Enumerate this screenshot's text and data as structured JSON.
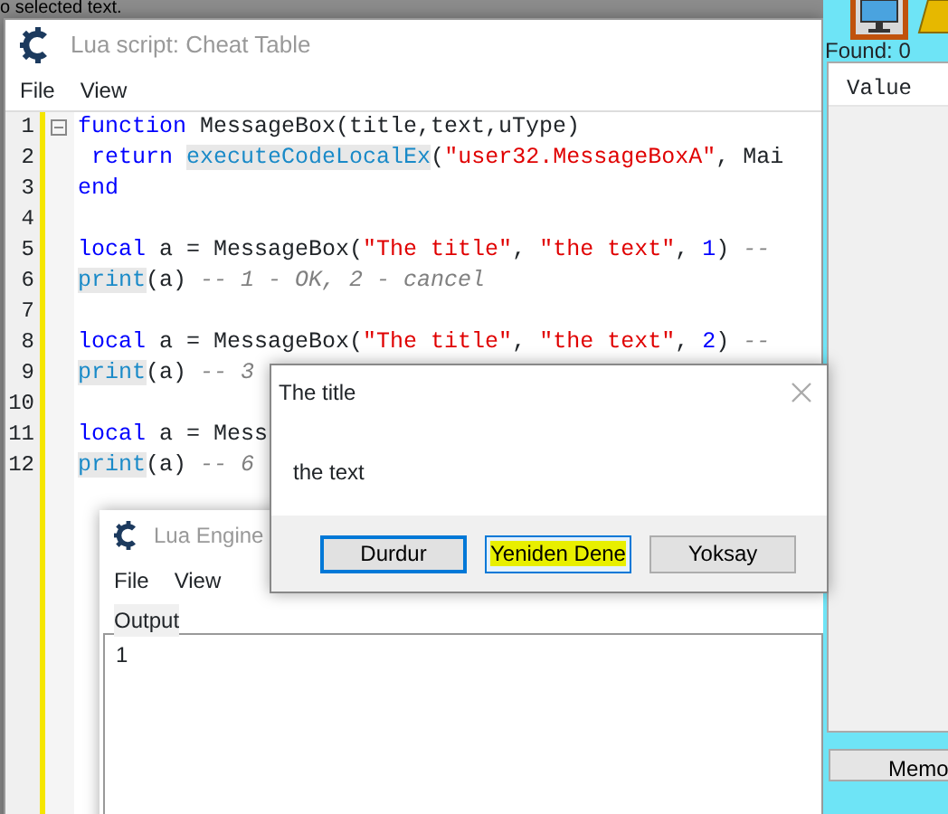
{
  "background": {
    "status_text": "o selected text."
  },
  "script_window": {
    "title": "Lua script: Cheat Table",
    "menu": [
      "File",
      "View"
    ],
    "lines": [
      {
        "number": "1",
        "fold": true,
        "tokens": [
          {
            "kind": "kw",
            "text": "function"
          },
          {
            "kind": "plain",
            "text": " MessageBox(title,text,uType)"
          }
        ]
      },
      {
        "number": "2",
        "fold": false,
        "tokens": [
          {
            "kind": "kw",
            "text": " return "
          },
          {
            "kind": "hl",
            "text": "executeCodeLocalEx"
          },
          {
            "kind": "plain",
            "text": "("
          },
          {
            "kind": "str",
            "text": "\"user32.MessageBoxA\""
          },
          {
            "kind": "plain",
            "text": ", Mai"
          }
        ]
      },
      {
        "number": "3",
        "fold": false,
        "tokens": [
          {
            "kind": "kw",
            "text": "end"
          }
        ]
      },
      {
        "number": "4",
        "fold": false
      },
      {
        "number": "5",
        "fold": false,
        "tokens": [
          {
            "kind": "kw",
            "text": "local"
          },
          {
            "kind": "plain",
            "text": " a = MessageBox("
          },
          {
            "kind": "str",
            "text": "\"The title\""
          },
          {
            "kind": "plain",
            "text": ", "
          },
          {
            "kind": "str",
            "text": "\"the text\""
          },
          {
            "kind": "plain",
            "text": ", "
          },
          {
            "kind": "num",
            "text": "1"
          },
          {
            "kind": "plain",
            "text": ") "
          },
          {
            "kind": "cmt",
            "text": "--"
          }
        ]
      },
      {
        "number": "6",
        "fold": false,
        "tokens": [
          {
            "kind": "hl",
            "text": "print"
          },
          {
            "kind": "plain",
            "text": "(a) "
          },
          {
            "kind": "cmt",
            "text": "-- 1 - OK, 2 - cancel"
          }
        ]
      },
      {
        "number": "7",
        "fold": false
      },
      {
        "number": "8",
        "fold": false,
        "tokens": [
          {
            "kind": "kw",
            "text": "local"
          },
          {
            "kind": "plain",
            "text": " a = MessageBox("
          },
          {
            "kind": "str",
            "text": "\"The title\""
          },
          {
            "kind": "plain",
            "text": ", "
          },
          {
            "kind": "str",
            "text": "\"the text\""
          },
          {
            "kind": "plain",
            "text": ", "
          },
          {
            "kind": "num",
            "text": "2"
          },
          {
            "kind": "plain",
            "text": ") "
          },
          {
            "kind": "cmt",
            "text": "--"
          }
        ]
      },
      {
        "number": "9",
        "fold": false,
        "tokens": [
          {
            "kind": "hl",
            "text": "print"
          },
          {
            "kind": "plain",
            "text": "(a) "
          },
          {
            "kind": "cmt",
            "text": "-- 3"
          }
        ]
      },
      {
        "number": "10",
        "fold": false
      },
      {
        "number": "11",
        "fold": false,
        "tokens": [
          {
            "kind": "kw",
            "text": "local"
          },
          {
            "kind": "plain",
            "text": " a = Mess"
          }
        ]
      },
      {
        "number": "12",
        "fold": false,
        "tokens": [
          {
            "kind": "hl",
            "text": "print"
          },
          {
            "kind": "plain",
            "text": "(a) "
          },
          {
            "kind": "cmt",
            "text": "-- 6"
          }
        ]
      }
    ]
  },
  "side_panel": {
    "found": "Found: 0",
    "column": "Value",
    "button": "Memo"
  },
  "engine_window": {
    "title": "Lua Engine",
    "menu": [
      "File",
      "View"
    ],
    "group": "Output",
    "output": "1"
  },
  "message_box": {
    "title": "The title",
    "text": "the text",
    "buttons": [
      {
        "label": "Durdur",
        "selected": true,
        "highlighted": false
      },
      {
        "label": "Yeniden Dene",
        "selected": false,
        "highlighted": true
      },
      {
        "label": "Yoksay",
        "selected": false,
        "highlighted": false
      }
    ]
  }
}
